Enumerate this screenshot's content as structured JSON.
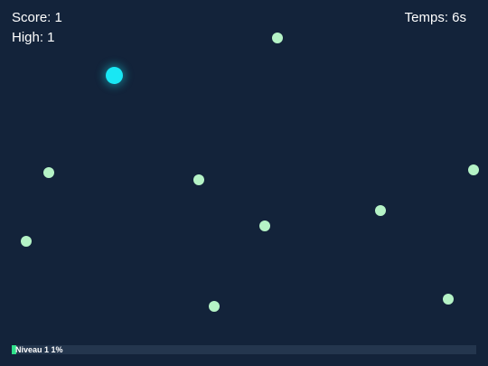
{
  "hud": {
    "score_text": "Score: 1",
    "high_text": "High: 1",
    "time_text": "Temps: 6s"
  },
  "level": {
    "label": "Niveau 1  1%",
    "progress_fraction": 0.01
  },
  "colors": {
    "background": "#13233a",
    "player": "#19e7f4",
    "food": "#b5f3c6",
    "progress_fill": "#2fe08a",
    "progress_track": "#24364e"
  }
}
